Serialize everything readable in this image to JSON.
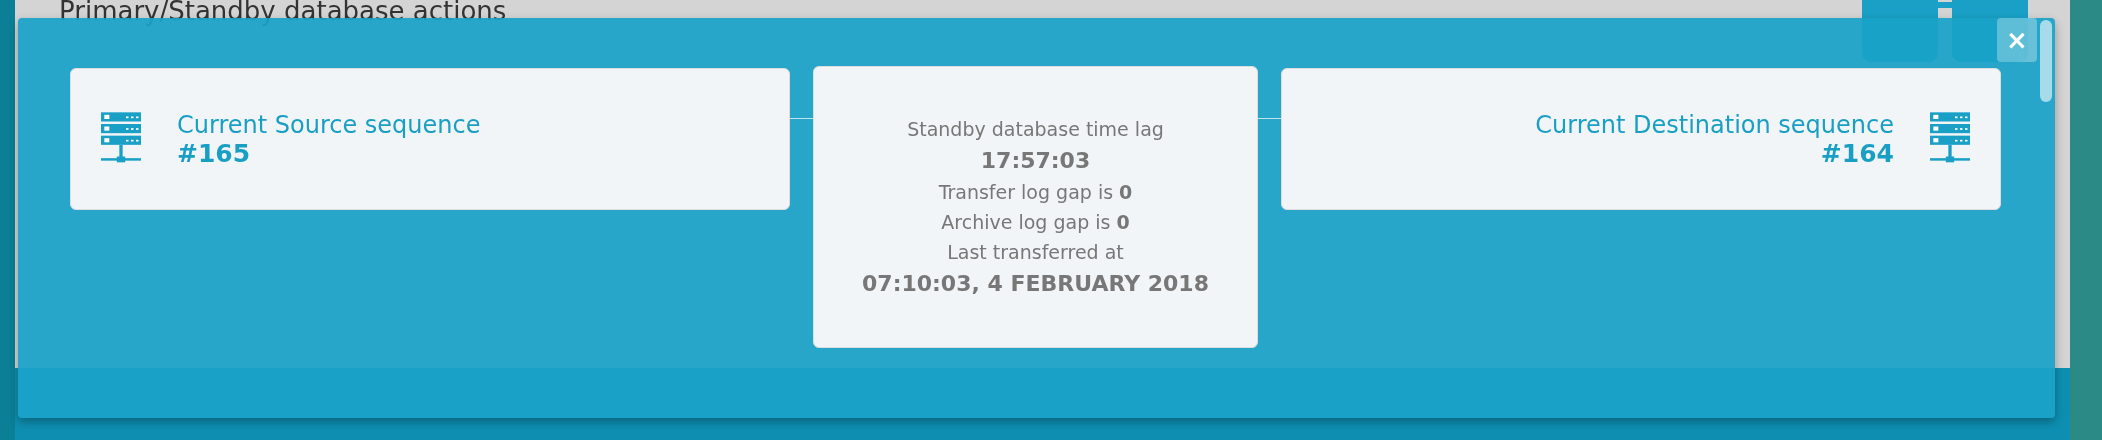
{
  "background": {
    "title": "Primary/Standby database actions"
  },
  "modal": {
    "close": "×",
    "source": {
      "title": "Current Source sequence",
      "value": "#165"
    },
    "lag": {
      "lines": [
        {
          "kind": "label",
          "text": "Standby database time lag"
        },
        {
          "kind": "value",
          "text": "17:57:03"
        },
        {
          "kind": "label",
          "text": "Transfer log gap is **0**"
        },
        {
          "kind": "label",
          "text": "Archive log gap is **0**"
        },
        {
          "kind": "label",
          "text": "Last transferred at"
        },
        {
          "kind": "value",
          "text": "07:10:03, 4 FEBRUARY 2018"
        }
      ]
    },
    "destination": {
      "title": "Current Destination sequence",
      "value": "#164"
    }
  }
}
